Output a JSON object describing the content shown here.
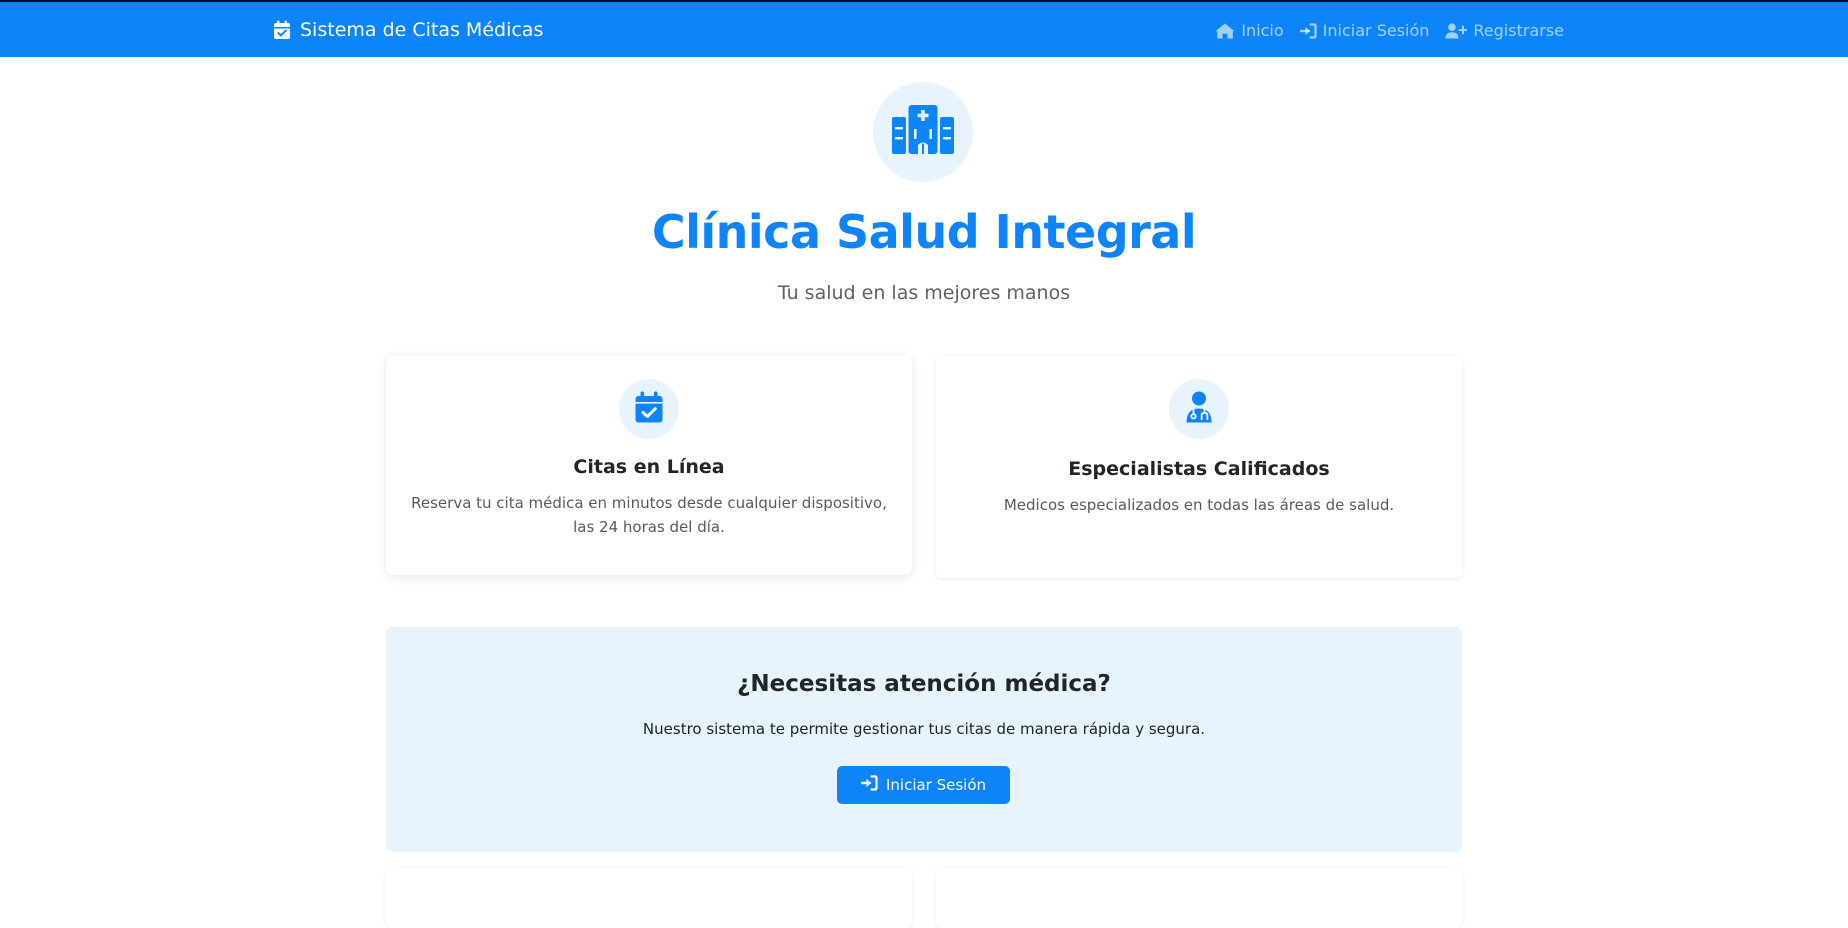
{
  "navbar": {
    "brand": "Sistema de Citas Médicas",
    "brand_icon": "calendar-check-icon",
    "links": [
      {
        "label": "Inicio",
        "icon": "home-icon"
      },
      {
        "label": "Iniciar Sesión",
        "icon": "sign-in-icon"
      },
      {
        "label": "Registrarse",
        "icon": "user-plus-icon"
      }
    ]
  },
  "hero": {
    "icon": "hospital-icon",
    "title": "Clínica Salud Integral",
    "subtitle": "Tu salud en las mejores manos"
  },
  "features": [
    {
      "icon": "calendar-check-icon",
      "title": "Citas en Línea",
      "text": "Reserva tu cita médica en minutos desde cualquier dispositivo, las 24 horas del día."
    },
    {
      "icon": "user-doctor-icon",
      "title": "Especialistas Calificados",
      "text": "Medicos especializados en todas las áreas de salud."
    }
  ],
  "cta": {
    "title": "¿Necesitas atención médica?",
    "text": "Nuestro sistema te permite gestionar tus citas de manera rápida y segura.",
    "button_label": "Iniciar Sesión",
    "button_icon": "sign-in-icon"
  },
  "colors": {
    "primary": "#0d84f9",
    "icon_bg": "#e7f3fe",
    "cta_bg": "#e7f4fd",
    "muted_text": "#5b6269"
  }
}
